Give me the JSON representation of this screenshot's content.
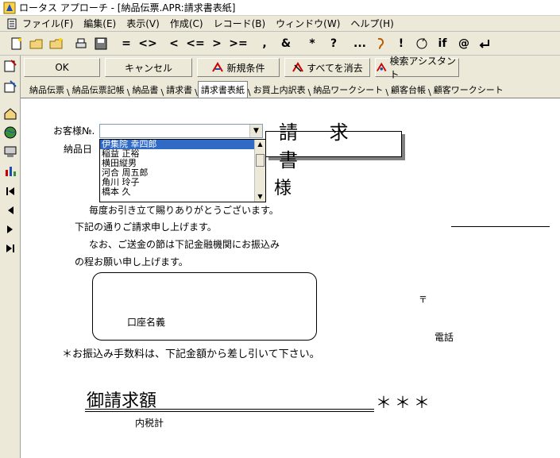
{
  "window": {
    "title": "ロータス アプローチ - [納品伝票.APR:請求書表紙]"
  },
  "menubar": {
    "items": [
      "ファイル(F)",
      "編集(E)",
      "表示(V)",
      "作成(C)",
      "レコード(B)",
      "ウィンドウ(W)",
      "ヘルプ(H)"
    ]
  },
  "toolbar": {
    "operators": [
      "=",
      "<>",
      "<",
      "<=",
      ">",
      ">=",
      ",",
      "&",
      "*",
      "?",
      "...",
      "!",
      "if",
      "@"
    ]
  },
  "cmdbar": {
    "ok": "OK",
    "cancel": "キャンセル",
    "new_condition": "新規条件",
    "clear_all": "すべてを消去",
    "search_assistant": "検索アシスタント"
  },
  "tabs": [
    "納品伝票",
    "納品伝票記帳",
    "納品書",
    "請求書",
    "請求書表紙",
    "お買上内訳表",
    "納品ワークシート",
    "顧客台帳",
    "顧客ワークシート"
  ],
  "form": {
    "customer_no_label": "お客様№.",
    "delivery_date_label": "納品日",
    "invoice_title": "請 求 書",
    "honorific": "様",
    "customer_list": [
      "伊集院 幸四郎",
      "稲益 正裕",
      "横田縦男",
      "河合 周五郎",
      "角川 玲子",
      "橋本 久"
    ],
    "greeting_lines": [
      "毎度お引き立て賜りありがとうございます。",
      "下記の通りご請求申し上げます。",
      "なお、ご送金の節は下記金融機関にお振込み",
      "の程お願い申し上げます。"
    ],
    "account_name_label": "口座名義",
    "postal_mark": "〒",
    "phone_label": "電話",
    "fee_note": "＊お振込み手数料は、下記金額から差し引いて下さい。",
    "total_label": "御請求額",
    "total_value": "＊＊＊",
    "tax_label": "内税計"
  }
}
